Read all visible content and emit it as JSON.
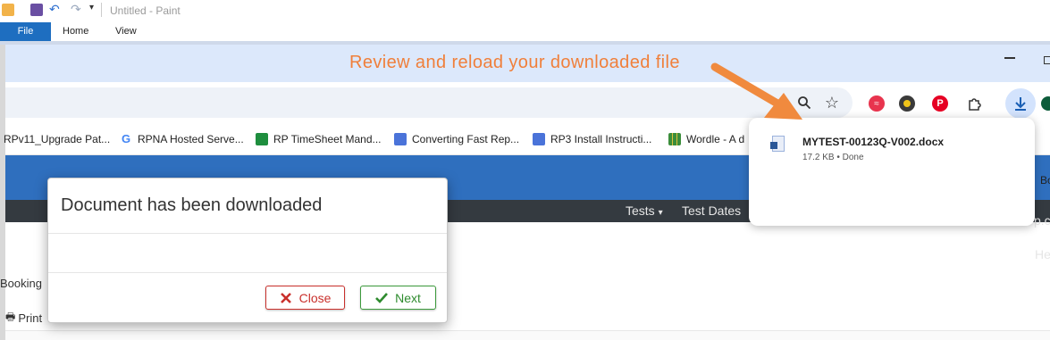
{
  "paint": {
    "title": "Untitled - Paint",
    "tabs": [
      "File",
      "Home",
      "View"
    ]
  },
  "annotation": "Review and reload your downloaded file",
  "bookmarks": [
    {
      "label": "RPv11_Upgrade Pat...",
      "icon": "doc-icon",
      "color": "#8a8a8a"
    },
    {
      "label": "RPNA Hosted Serve...",
      "icon": "google-icon",
      "color": "#4285f4"
    },
    {
      "label": "RP TimeSheet Mand...",
      "icon": "sheets-icon",
      "color": "#1e8e3e"
    },
    {
      "label": "Converting Fast Rep...",
      "icon": "docs-icon",
      "color": "#4a73d9"
    },
    {
      "label": "RP3 Install Instructi...",
      "icon": "docs-icon",
      "color": "#4a73d9"
    },
    {
      "label": "Wordle - A d",
      "icon": "wordle-icon",
      "color": "#3b8d3b"
    }
  ],
  "bookmark_cut": "Bo",
  "nav": {
    "tests": "Tests",
    "test_dates": "Test Dates",
    "he_cut": "He",
    "pc_cut": "p.c"
  },
  "download": {
    "filename": "MYTEST-00123Q-V002.docx",
    "meta": "17.2 KB • Done"
  },
  "modal": {
    "title": "Document has been downloaded",
    "close_label": "Close",
    "next_label": "Next"
  },
  "page": {
    "booking": "Booking",
    "print": "Print"
  },
  "colors": {
    "annotation": "#f07f3a",
    "close": "#c9302c",
    "next": "#2e8b2e",
    "app_bar": "#2f6fbe"
  }
}
